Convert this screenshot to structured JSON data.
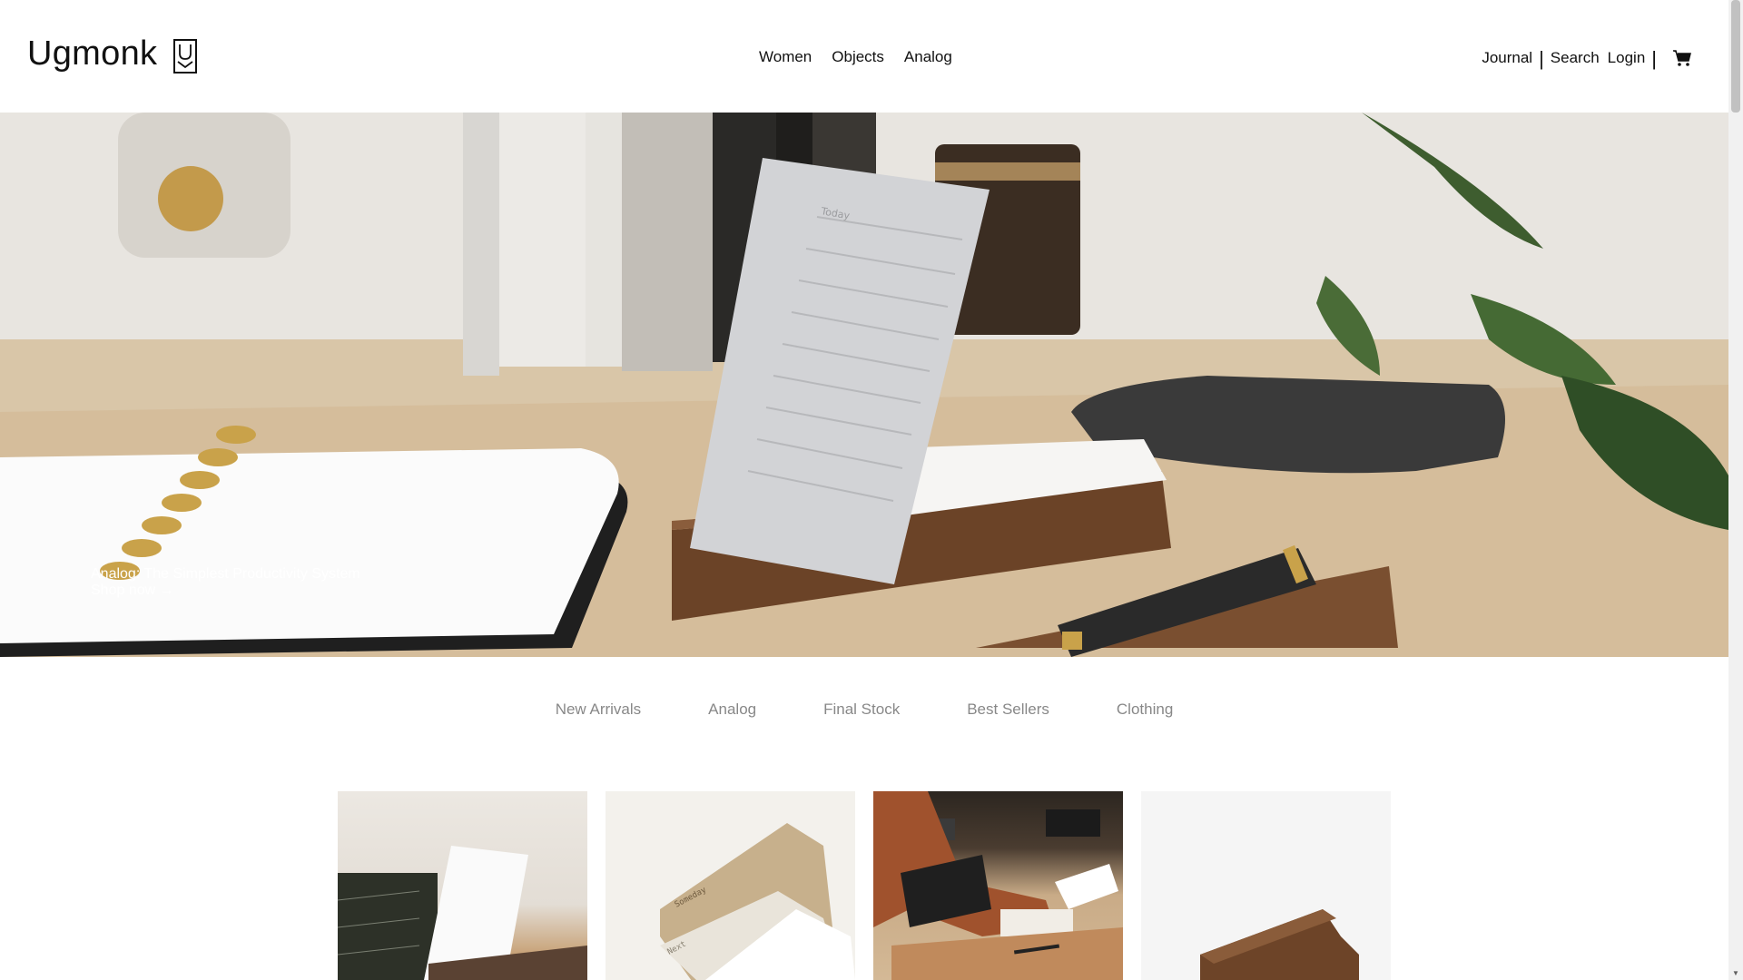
{
  "brand": {
    "name": "Ugmonk"
  },
  "main_nav": [
    "Women",
    "Objects",
    "Analog"
  ],
  "util_nav": {
    "journal": "Journal",
    "search": "Search",
    "login": "Login",
    "separator": "|"
  },
  "hero": {
    "headline": "Analog: The Simplest Productivity System",
    "cta": "Shop now →",
    "card_title": "Today"
  },
  "category_tabs": [
    "New Arrivals",
    "Analog",
    "Final Stock",
    "Best Sellers",
    "Clothing"
  ],
  "products": [
    {
      "card_label": ""
    },
    {
      "card_label_1": "Someday",
      "card_label_2": "Next"
    },
    {
      "card_label": ""
    },
    {
      "card_label": ""
    }
  ],
  "colors": {
    "text": "#111111",
    "muted": "#888888",
    "walnut": "#7a5234",
    "brass": "#c9a24a"
  },
  "icons": {
    "cart": "cart-icon",
    "logo_mark": "ugmonk-u-mark-icon"
  }
}
